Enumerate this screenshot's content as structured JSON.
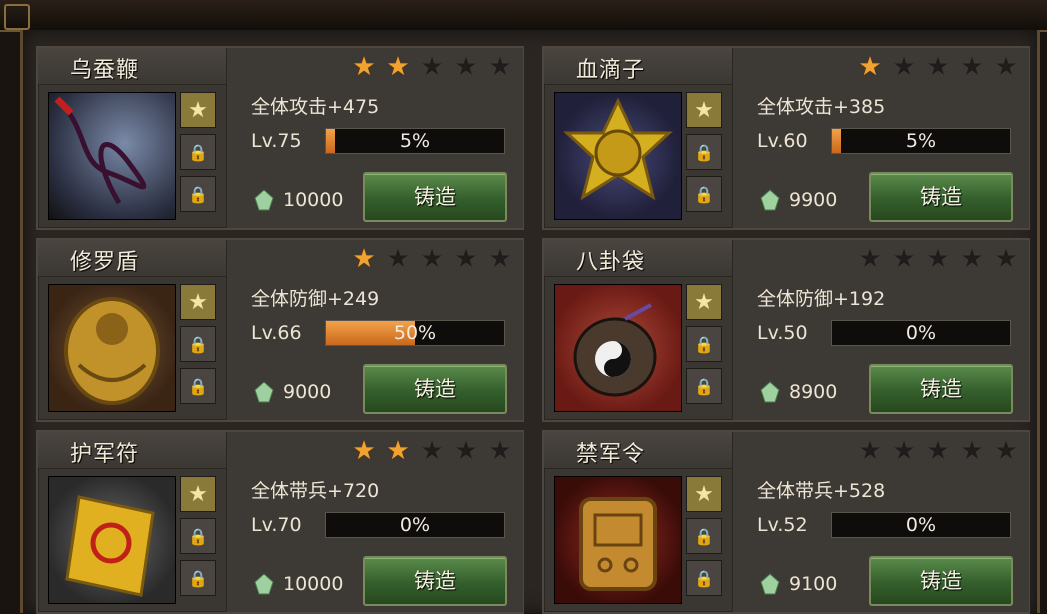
{
  "cards": [
    {
      "name": "乌蚕鞭",
      "stars": 2,
      "stat": "全体攻击+475",
      "level": "Lv.75",
      "progress_pct": 5,
      "progress_text": "5%",
      "cost": "10000",
      "button": "铸造",
      "icon": "whip-icon"
    },
    {
      "name": "血滴子",
      "stars": 1,
      "stat": "全体攻击+385",
      "level": "Lv.60",
      "progress_pct": 5,
      "progress_text": "5%",
      "cost": "9900",
      "button": "铸造",
      "icon": "blade-disc-icon"
    },
    {
      "name": "修罗盾",
      "stars": 1,
      "stat": "全体防御+249",
      "level": "Lv.66",
      "progress_pct": 50,
      "progress_text": "50%",
      "cost": "9000",
      "button": "铸造",
      "icon": "shield-icon"
    },
    {
      "name": "八卦袋",
      "stars": 0,
      "stat": "全体防御+192",
      "level": "Lv.50",
      "progress_pct": 0,
      "progress_text": "0%",
      "cost": "8900",
      "button": "铸造",
      "icon": "bagua-bag-icon"
    },
    {
      "name": "护军符",
      "stars": 2,
      "stat": "全体带兵+720",
      "level": "Lv.70",
      "progress_pct": 0,
      "progress_text": "0%",
      "cost": "10000",
      "button": "铸造",
      "icon": "talisman-icon"
    },
    {
      "name": "禁军令",
      "stars": 0,
      "stat": "全体带兵+528",
      "level": "Lv.52",
      "progress_pct": 0,
      "progress_text": "0%",
      "cost": "9100",
      "button": "铸造",
      "icon": "token-icon"
    }
  ],
  "colors": {
    "star_on": "#f0a232",
    "star_off": "#1f1d1b",
    "bar_fill": "#e08a34",
    "button": "#3f6e34"
  }
}
